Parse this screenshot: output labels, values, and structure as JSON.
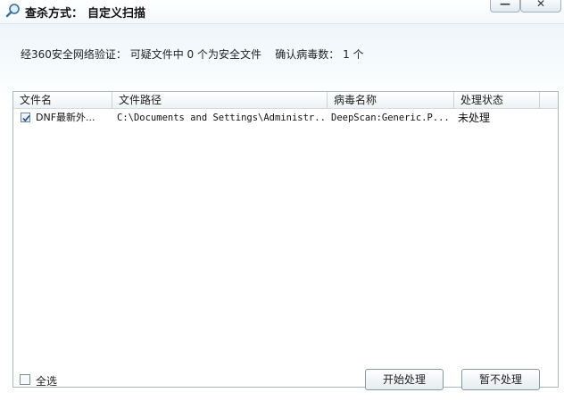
{
  "titlebar": {
    "label": "查杀方式：",
    "value": "自定义扫描",
    "minimize_glyph": "—",
    "close_glyph": "✕"
  },
  "summary": {
    "prefix": "经360安全网络验证：",
    "suspect": "可疑文件中 0 个为安全文件",
    "confirmed": "确认病毒数： 1 个"
  },
  "table": {
    "columns": [
      "文件名",
      "文件路径",
      "病毒名称",
      "处理状态"
    ],
    "rows": [
      {
        "checked": true,
        "filename": "DNF最新外...",
        "path": "C:\\Documents and Settings\\Administr...",
        "virus": "DeepScan:Generic.P...",
        "status": "未处理"
      }
    ]
  },
  "footer": {
    "select_all_label": "全选",
    "button1_label": "开始处理",
    "button2_label": "暂不处理"
  },
  "icons": {
    "title": "search-icon",
    "check": "checkmark-icon"
  }
}
